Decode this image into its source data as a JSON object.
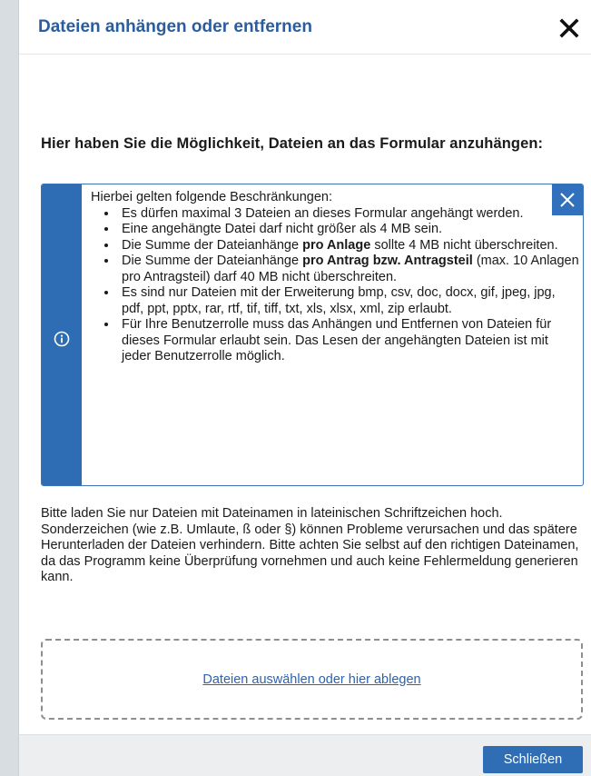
{
  "dialog": {
    "title": "Dateien anhängen oder entfernen"
  },
  "intro": {
    "heading": "Hier haben Sie die Möglichkeit, Dateien an das Formular anzuhängen:"
  },
  "info": {
    "lead": "Hierbei gelten folgende Beschränkungen:",
    "items": [
      {
        "text": "Es dürfen maximal 3 Dateien an dieses Formular angehängt werden."
      },
      {
        "text": "Eine angehängte Datei darf nicht größer als 4 MB sein."
      },
      {
        "pre": "Die Summe der Dateianhänge ",
        "bold": "pro Anlage",
        "post": " sollte 4 MB nicht überschreiten."
      },
      {
        "pre": "Die Summe der Dateianhänge ",
        "bold": "pro Antrag bzw. Antragsteil",
        "post": " (max. 10 Anlagen pro Antragsteil) darf 40 MB nicht überschreiten."
      },
      {
        "text": "Es sind nur Dateien mit der Erweiterung bmp, csv, doc, docx, gif, jpeg, jpg, pdf, ppt, pptx, rar, rtf, tif, tiff, txt, xls, xlsx, xml, zip erlaubt."
      },
      {
        "text": "Für Ihre Benutzerrolle muss das Anhängen und Entfernen von Dateien für dieses Formular erlaubt sein. Das Lesen der angehängten Dateien ist mit jeder Benutzerrolle möglich."
      }
    ]
  },
  "note": {
    "text": "Bitte laden Sie nur Dateien mit Dateinamen in lateinischen Schriftzeichen hoch. Sonderzeichen (wie z.B. Umlaute, ß oder §) können Probleme verursachen und das spätere Herunterladen der Dateien verhindern. Bitte achten Sie selbst auf den richtigen Dateinamen, da das Programm keine Überprüfung vornehmen und auch keine Fehlermeldung generieren kann."
  },
  "dropzone": {
    "link_label": "Dateien auswählen oder hier ablegen"
  },
  "footer": {
    "close_label": "Schließen"
  },
  "icons": {
    "close": "close-icon",
    "info": "info-icon",
    "info_close": "info-close-icon"
  },
  "colors": {
    "accent": "#2e6db4",
    "title": "#2a5d9f",
    "link": "#2c62b0"
  }
}
